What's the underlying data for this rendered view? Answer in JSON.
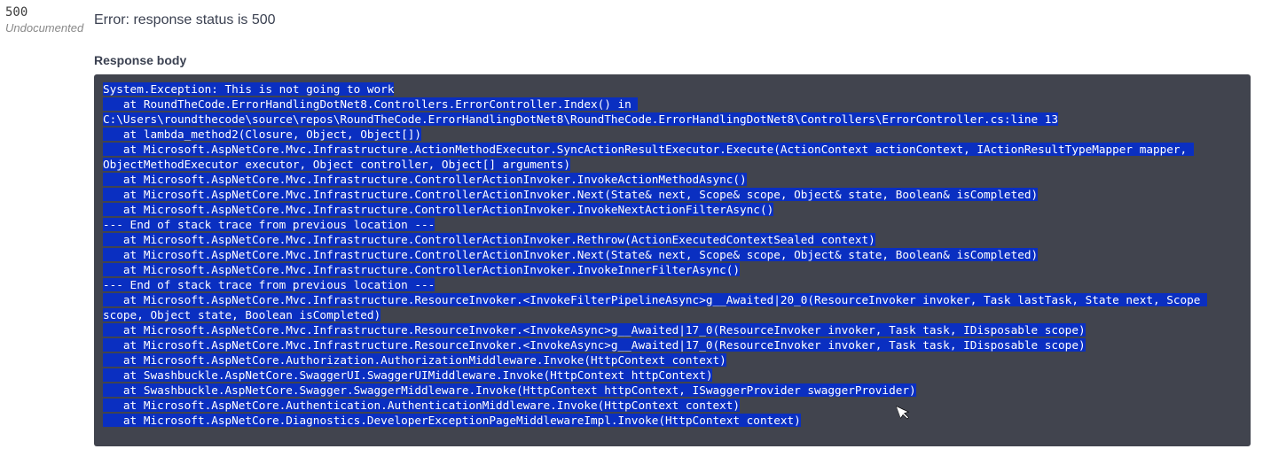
{
  "status": {
    "code": "500",
    "undocumented": "Undocumented"
  },
  "error_line": "Error: response status is 500",
  "response_body_label": "Response body",
  "stack_trace": "System.Exception: This is not going to work\n   at RoundTheCode.ErrorHandlingDotNet8.Controllers.ErrorController.Index() in C:\\Users\\roundthecode\\source\\repos\\RoundTheCode.ErrorHandlingDotNet8\\RoundTheCode.ErrorHandlingDotNet8\\Controllers\\ErrorController.cs:line 13\n   at lambda_method2(Closure, Object, Object[])\n   at Microsoft.AspNetCore.Mvc.Infrastructure.ActionMethodExecutor.SyncActionResultExecutor.Execute(ActionContext actionContext, IActionResultTypeMapper mapper, ObjectMethodExecutor executor, Object controller, Object[] arguments)\n   at Microsoft.AspNetCore.Mvc.Infrastructure.ControllerActionInvoker.InvokeActionMethodAsync()\n   at Microsoft.AspNetCore.Mvc.Infrastructure.ControllerActionInvoker.Next(State& next, Scope& scope, Object& state, Boolean& isCompleted)\n   at Microsoft.AspNetCore.Mvc.Infrastructure.ControllerActionInvoker.InvokeNextActionFilterAsync()\n--- End of stack trace from previous location ---\n   at Microsoft.AspNetCore.Mvc.Infrastructure.ControllerActionInvoker.Rethrow(ActionExecutedContextSealed context)\n   at Microsoft.AspNetCore.Mvc.Infrastructure.ControllerActionInvoker.Next(State& next, Scope& scope, Object& state, Boolean& isCompleted)\n   at Microsoft.AspNetCore.Mvc.Infrastructure.ControllerActionInvoker.InvokeInnerFilterAsync()\n--- End of stack trace from previous location ---\n   at Microsoft.AspNetCore.Mvc.Infrastructure.ResourceInvoker.<InvokeFilterPipelineAsync>g__Awaited|20_0(ResourceInvoker invoker, Task lastTask, State next, Scope scope, Object state, Boolean isCompleted)\n   at Microsoft.AspNetCore.Mvc.Infrastructure.ResourceInvoker.<InvokeAsync>g__Awaited|17_0(ResourceInvoker invoker, Task task, IDisposable scope)\n   at Microsoft.AspNetCore.Mvc.Infrastructure.ResourceInvoker.<InvokeAsync>g__Awaited|17_0(ResourceInvoker invoker, Task task, IDisposable scope)\n   at Microsoft.AspNetCore.Authorization.AuthorizationMiddleware.Invoke(HttpContext context)\n   at Swashbuckle.AspNetCore.SwaggerUI.SwaggerUIMiddleware.Invoke(HttpContext httpContext)\n   at Swashbuckle.AspNetCore.Swagger.SwaggerMiddleware.Invoke(HttpContext httpContext, ISwaggerProvider swaggerProvider)\n   at Microsoft.AspNetCore.Authentication.AuthenticationMiddleware.Invoke(HttpContext context)\n   at Microsoft.AspNetCore.Diagnostics.DeveloperExceptionPageMiddlewareImpl.Invoke(HttpContext context)"
}
